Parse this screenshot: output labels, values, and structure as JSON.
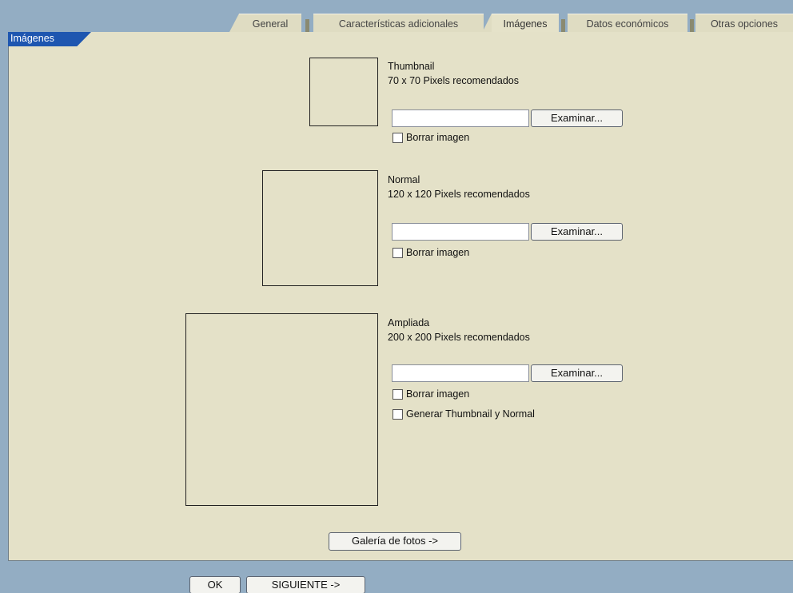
{
  "tabs": [
    {
      "label": "General"
    },
    {
      "label": "Características adicionales"
    },
    {
      "label": "Imágenes"
    },
    {
      "label": "Datos económicos"
    },
    {
      "label": "Otras opciones"
    }
  ],
  "active_tab": "Imágenes",
  "section_label": "Imágenes",
  "images": [
    {
      "name": "Thumbnail",
      "recommended": "70 x 70 Pixels recomendados",
      "browse_label": "Examinar...",
      "file_value": "",
      "delete_label": "Borrar imagen"
    },
    {
      "name": "Normal",
      "recommended": "120 x 120 Pixels recomendados",
      "browse_label": "Examinar...",
      "file_value": "",
      "delete_label": "Borrar imagen"
    },
    {
      "name": "Ampliada",
      "recommended": "200 x 200 Pixels recomendados",
      "browse_label": "Examinar...",
      "file_value": "",
      "delete_label": "Borrar imagen",
      "generate_label": "Generar Thumbnail y Normal"
    }
  ],
  "gallery_button": "Galería de fotos ->",
  "footer": {
    "ok_label": "OK",
    "next_label": "SIGUIENTE ->"
  },
  "colors": {
    "background": "#93adc3",
    "panel": "#e4e1c8",
    "section_label_bg": "#1e56b0"
  }
}
